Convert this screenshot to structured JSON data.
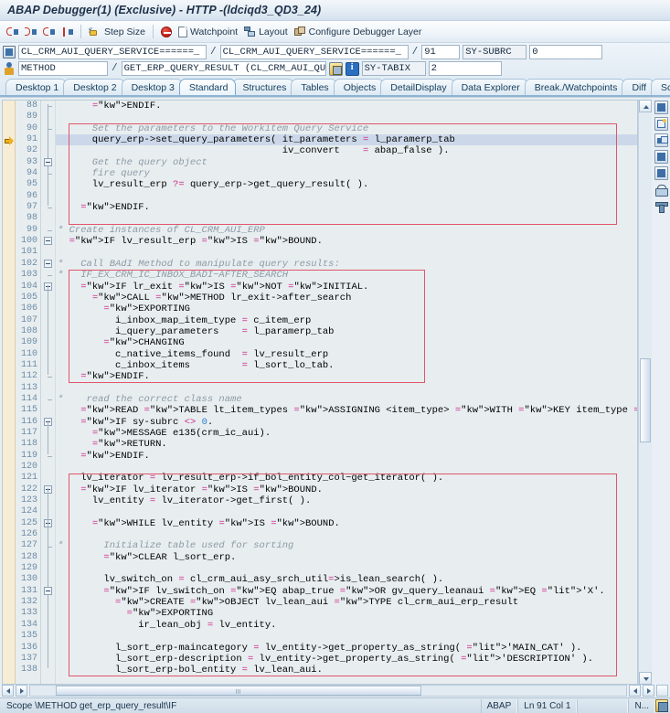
{
  "window": {
    "title": "ABAP Debugger(1)  (Exclusive) - HTTP -(ldciqd3_QD3_24)"
  },
  "toolbar": {
    "buttons": [
      {
        "name": "step-into-button",
        "label": ""
      },
      {
        "name": "step-over-button",
        "label": ""
      },
      {
        "name": "step-return-button",
        "label": ""
      },
      {
        "name": "step-continue-button",
        "label": ""
      },
      {
        "name": "step-size-button",
        "label": "Step Size"
      },
      {
        "name": "breakpoint-button",
        "label": ""
      },
      {
        "name": "watchpoint-button",
        "label": "Watchpoint"
      },
      {
        "name": "layout-button",
        "label": "Layout"
      },
      {
        "name": "configure-debugger-layer-button",
        "label": "Configure Debugger Layer"
      }
    ]
  },
  "fields": {
    "row1": {
      "program": "CL_CRM_AUI_QUERY_SERVICE======_",
      "include": "CL_CRM_AUI_QUERY_SERVICE======_",
      "line": "91",
      "sys_label": "SY-SUBRC",
      "sys_value": "0",
      "sep": "/"
    },
    "row2": {
      "type": "METHOD",
      "method": "GET_ERP_QUERY_RESULT (CL_CRM_AUI_QUERY_SERV_",
      "sys_label": "SY-TABIX",
      "sys_value": "2",
      "sep": "/"
    }
  },
  "tabs": [
    {
      "label": "Desktop 1",
      "active": false
    },
    {
      "label": "Desktop 2",
      "active": false
    },
    {
      "label": "Desktop 3",
      "active": false
    },
    {
      "label": "Standard",
      "active": true
    },
    {
      "label": "Structures",
      "active": false
    },
    {
      "label": "Tables",
      "active": false
    },
    {
      "label": "Objects",
      "active": false
    },
    {
      "label": "DetailDisplay",
      "active": false
    },
    {
      "label": "Data Explorer",
      "active": false
    },
    {
      "label": "Break./Watchpoints",
      "active": false
    },
    {
      "label": "Diff",
      "active": false
    },
    {
      "label": "Script",
      "active": false
    }
  ],
  "code": {
    "current_line": 91,
    "first_line": 88,
    "lines": [
      {
        "n": 88,
        "text": "      ENDIF."
      },
      {
        "n": 89,
        "text": ""
      },
      {
        "n": 90,
        "text": "      Set the parameters to the Workitem Query Service"
      },
      {
        "n": 91,
        "text": "      query_erp->set_query_parameters( it_parameters = l_paramerp_tab"
      },
      {
        "n": 92,
        "text": "                                       iv_convert    = abap_false )."
      },
      {
        "n": 93,
        "text": "      Get the query object"
      },
      {
        "n": 94,
        "text": "      fire query"
      },
      {
        "n": 95,
        "text": "      lv_result_erp ?= query_erp->get_query_result( )."
      },
      {
        "n": 96,
        "text": ""
      },
      {
        "n": 97,
        "text": "    ENDIF."
      },
      {
        "n": 98,
        "text": ""
      },
      {
        "n": 99,
        "text": "* Create instances of CL_CRM_AUI_ERP"
      },
      {
        "n": 100,
        "text": "  IF lv_result_erp IS BOUND."
      },
      {
        "n": 101,
        "text": ""
      },
      {
        "n": 102,
        "text": "*   Call BAdI Method to manipulate query results:"
      },
      {
        "n": 103,
        "text": "*   IF_EX_CRM_IC_INBOX_BADI~AFTER_SEARCH"
      },
      {
        "n": 104,
        "text": "    IF lr_exit IS NOT INITIAL."
      },
      {
        "n": 105,
        "text": "      CALL METHOD lr_exit->after_search"
      },
      {
        "n": 106,
        "text": "        EXPORTING"
      },
      {
        "n": 107,
        "text": "          i_inbox_map_item_type = c_item_erp"
      },
      {
        "n": 108,
        "text": "          i_query_parameters    = l_paramerp_tab"
      },
      {
        "n": 109,
        "text": "        CHANGING"
      },
      {
        "n": 110,
        "text": "          c_native_items_found  = lv_result_erp"
      },
      {
        "n": 111,
        "text": "          c_inbox_items         = l_sort_lo_tab."
      },
      {
        "n": 112,
        "text": "    ENDIF."
      },
      {
        "n": 113,
        "text": ""
      },
      {
        "n": 114,
        "text": "*    read the correct class name"
      },
      {
        "n": 115,
        "text": "    READ TABLE lt_item_types ASSIGNING <item_type> WITH KEY item_type = c_item_erp."
      },
      {
        "n": 116,
        "text": "    IF sy-subrc <> 0."
      },
      {
        "n": 117,
        "text": "      MESSAGE e135(crm_ic_aui)."
      },
      {
        "n": 118,
        "text": "      RETURN."
      },
      {
        "n": 119,
        "text": "    ENDIF."
      },
      {
        "n": 120,
        "text": ""
      },
      {
        "n": 121,
        "text": "    lv_iterator = lv_result_erp->if_bol_entity_col~get_iterator( )."
      },
      {
        "n": 122,
        "text": "    IF lv_iterator IS BOUND."
      },
      {
        "n": 123,
        "text": "      lv_entity = lv_iterator->get_first( )."
      },
      {
        "n": 124,
        "text": ""
      },
      {
        "n": 125,
        "text": "      WHILE lv_entity IS BOUND."
      },
      {
        "n": 126,
        "text": ""
      },
      {
        "n": 127,
        "text": "*       Initialize table used for sorting"
      },
      {
        "n": 128,
        "text": "        CLEAR l_sort_erp."
      },
      {
        "n": 129,
        "text": ""
      },
      {
        "n": 130,
        "text": "        lv_switch_on = cl_crm_aui_asy_srch_util=>is_lean_search( )."
      },
      {
        "n": 131,
        "text": "        IF lv_switch_on EQ abap_true OR gv_query_leanaui EQ 'X'."
      },
      {
        "n": 132,
        "text": "          CREATE OBJECT lv_lean_aui TYPE cl_crm_aui_erp_result"
      },
      {
        "n": 133,
        "text": "            EXPORTING"
      },
      {
        "n": 134,
        "text": "              ir_lean_obj = lv_entity."
      },
      {
        "n": 135,
        "text": ""
      },
      {
        "n": 136,
        "text": "          l_sort_erp-maincategory = lv_entity->get_property_as_string( 'MAIN_CAT' )."
      },
      {
        "n": 137,
        "text": "          l_sort_erp-description = lv_entity->get_property_as_string( 'DESCRIPTION' )."
      },
      {
        "n": 138,
        "text": "          l_sort_erp-bol_entity = lv_lean_aui."
      }
    ]
  },
  "statusbar": {
    "scope": "Scope \\METHOD get_erp_query_result\\IF",
    "language": "ABAP",
    "position": "Ln 91 Col  1",
    "mode": "N..."
  },
  "colors": {
    "accent": "#3d6ea8",
    "highlight_row": "#ccd8ea",
    "redbox": "#e0566a",
    "comment": "#8c9aa6",
    "keyword": "#1a1ae0",
    "literal": "#1f9d55"
  }
}
